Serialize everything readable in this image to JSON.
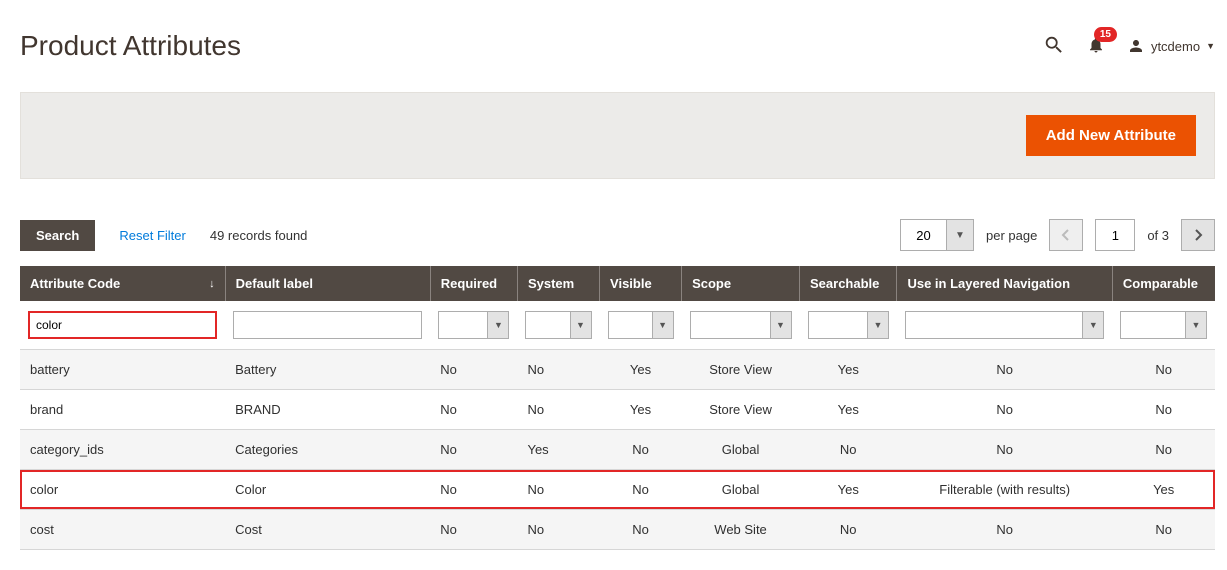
{
  "header": {
    "title": "Product Attributes",
    "notif_count": "15",
    "username": "ytcdemo"
  },
  "actions": {
    "add_button": "Add New Attribute"
  },
  "toolbar": {
    "search_label": "Search",
    "reset_label": "Reset Filter",
    "records_text": "49 records found",
    "perpage_value": "20",
    "perpage_label": "per page",
    "page_value": "1",
    "page_of": "of 3"
  },
  "columns": [
    {
      "label": "Attribute Code",
      "sort": "↓"
    },
    {
      "label": "Default label"
    },
    {
      "label": "Required"
    },
    {
      "label": "System"
    },
    {
      "label": "Visible"
    },
    {
      "label": "Scope"
    },
    {
      "label": "Searchable"
    },
    {
      "label": "Use in Layered Navigation"
    },
    {
      "label": "Comparable"
    }
  ],
  "filters": {
    "attribute_code": "color"
  },
  "rows": [
    {
      "code": "battery",
      "label": "Battery",
      "required": "No",
      "system": "No",
      "visible": "Yes",
      "scope": "Store View",
      "searchable": "Yes",
      "layered": "No",
      "comparable": "No",
      "hl": false
    },
    {
      "code": "brand",
      "label": "BRAND",
      "required": "No",
      "system": "No",
      "visible": "Yes",
      "scope": "Store View",
      "searchable": "Yes",
      "layered": "No",
      "comparable": "No",
      "hl": false
    },
    {
      "code": "category_ids",
      "label": "Categories",
      "required": "No",
      "system": "Yes",
      "visible": "No",
      "scope": "Global",
      "searchable": "No",
      "layered": "No",
      "comparable": "No",
      "hl": false
    },
    {
      "code": "color",
      "label": "Color",
      "required": "No",
      "system": "No",
      "visible": "No",
      "scope": "Global",
      "searchable": "Yes",
      "layered": "Filterable (with results)",
      "comparable": "Yes",
      "hl": true
    },
    {
      "code": "cost",
      "label": "Cost",
      "required": "No",
      "system": "No",
      "visible": "No",
      "scope": "Web Site",
      "searchable": "No",
      "layered": "No",
      "comparable": "No",
      "hl": false
    }
  ]
}
